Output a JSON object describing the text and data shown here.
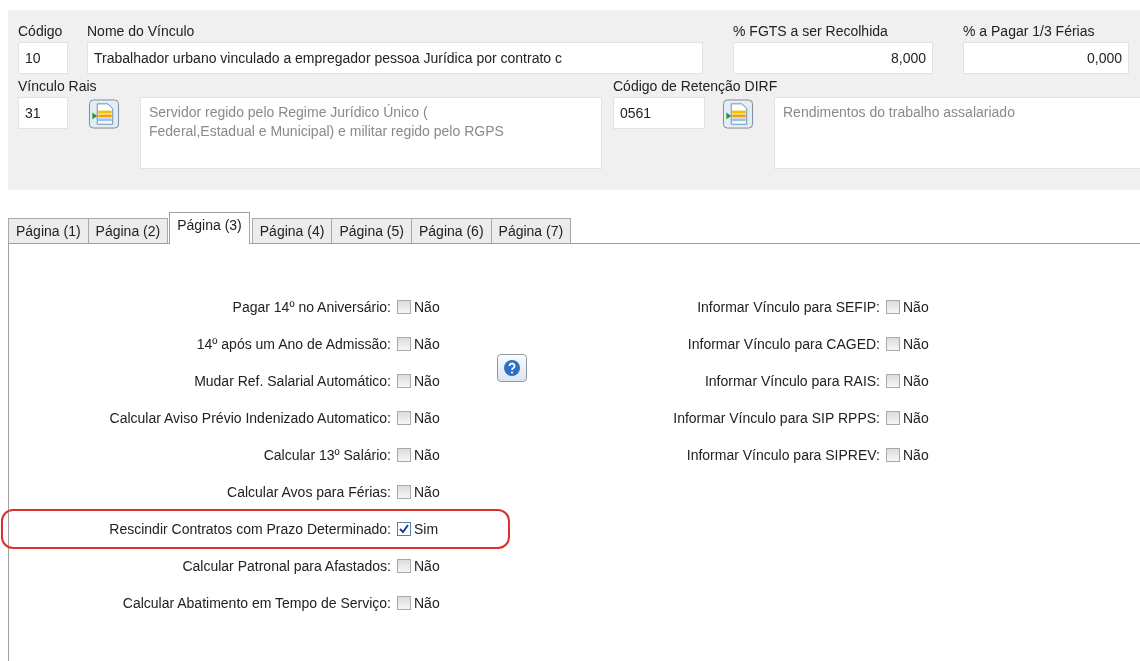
{
  "header": {
    "codigo": {
      "label": "Código",
      "value": "10"
    },
    "nome": {
      "label": "Nome do Vínculo",
      "value": "Trabalhador urbano vinculado a empregador pessoa Jurídica por contrato c"
    },
    "fgts": {
      "label": "% FGTS a ser Recolhida",
      "value": "8,000"
    },
    "ferias": {
      "label": "% a Pagar 1/3 Férias",
      "value": "0,000"
    },
    "rais": {
      "label": "Vínculo Rais",
      "code": "31",
      "description": "Servidor regido pelo Regime Jurídico Único ( Federal,Estadual e Municipal) e militar regido pelo RGPS"
    },
    "dirf": {
      "label": "Código de Retenção DIRF",
      "code": "0561",
      "description": "Rendimentos do trabalho assalariado"
    }
  },
  "tabs": [
    {
      "label": "Página (1)",
      "selected": false
    },
    {
      "label": "Página (2)",
      "selected": false
    },
    {
      "label": "Página (3)",
      "selected": true
    },
    {
      "label": "Página (4)",
      "selected": false
    },
    {
      "label": "Página (5)",
      "selected": false
    },
    {
      "label": "Página (6)",
      "selected": false
    },
    {
      "label": "Página (7)",
      "selected": false
    }
  ],
  "left_options": [
    {
      "label": "Pagar 14º no Aniversário:",
      "checked": false,
      "value": "Não",
      "highlighted": false
    },
    {
      "label": "14º após um Ano de Admissão:",
      "checked": false,
      "value": "Não",
      "highlighted": false
    },
    {
      "label": "Mudar Ref. Salarial Automático:",
      "checked": false,
      "value": "Não",
      "highlighted": false
    },
    {
      "label": "Calcular Aviso Prévio Indenizado Automatico:",
      "checked": false,
      "value": "Não",
      "highlighted": false
    },
    {
      "label": "Calcular 13º Salário:",
      "checked": false,
      "value": "Não",
      "highlighted": false
    },
    {
      "label": "Calcular Avos para Férias:",
      "checked": false,
      "value": "Não",
      "highlighted": false
    },
    {
      "label": "Rescindir Contratos com Prazo Determinado:",
      "checked": true,
      "value": "Sim",
      "highlighted": true
    },
    {
      "label": "Calcular Patronal para Afastados:",
      "checked": false,
      "value": "Não",
      "highlighted": false
    },
    {
      "label": "Calcular Abatimento em Tempo de Serviço:",
      "checked": false,
      "value": "Não",
      "highlighted": false
    }
  ],
  "right_options": [
    {
      "label": "Informar Vínculo para SEFIP:",
      "checked": false,
      "value": "Não"
    },
    {
      "label": "Informar Vínculo para CAGED:",
      "checked": false,
      "value": "Não"
    },
    {
      "label": "Informar Vínculo para RAIS:",
      "checked": false,
      "value": "Não"
    },
    {
      "label": "Informar Vínculo para SIP RPPS:",
      "checked": false,
      "value": "Não"
    },
    {
      "label": "Informar Vínculo para SIPREV:",
      "checked": false,
      "value": "Não"
    }
  ]
}
